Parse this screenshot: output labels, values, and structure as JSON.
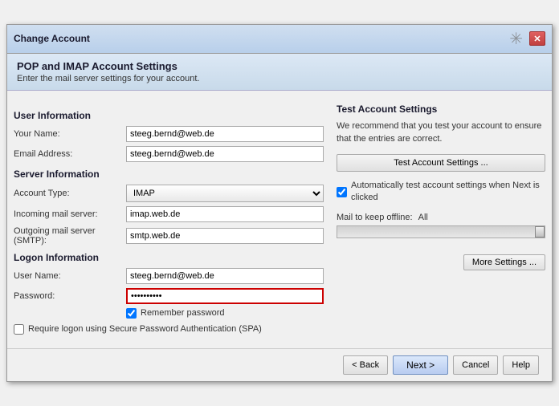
{
  "window": {
    "title": "Change Account",
    "close_label": "✕"
  },
  "header": {
    "title": "POP and IMAP Account Settings",
    "subtitle": "Enter the mail server settings for your account."
  },
  "left": {
    "user_info_title": "User Information",
    "your_name_label": "Your Name:",
    "your_name_value": "steeg.bernd@web.de",
    "email_label": "Email Address:",
    "email_value": "steeg.bernd@web.de",
    "server_info_title": "Server Information",
    "account_type_label": "Account Type:",
    "account_type_value": "IMAP",
    "incoming_label": "Incoming mail server:",
    "incoming_value": "imap.web.de",
    "outgoing_label": "Outgoing mail server (SMTP):",
    "outgoing_value": "smtp.web.de",
    "logon_info_title": "Logon Information",
    "username_label": "User Name:",
    "username_value": "steeg.bernd@web.de",
    "password_label": "Password:",
    "password_value": "**********",
    "remember_password_label": "Remember password",
    "require_logon_label": "Require logon using Secure Password Authentication (SPA)"
  },
  "right": {
    "title": "Test Account Settings",
    "description": "We recommend that you test your account to ensure that the entries are correct.",
    "test_btn_label": "Test Account Settings ...",
    "auto_test_label": "Automatically test account settings when Next is clicked",
    "offline_label": "Mail to keep offline:",
    "offline_value": "All",
    "more_settings_label": "More Settings ..."
  },
  "footer": {
    "back_label": "< Back",
    "next_label": "Next >",
    "cancel_label": "Cancel",
    "help_label": "Help"
  }
}
